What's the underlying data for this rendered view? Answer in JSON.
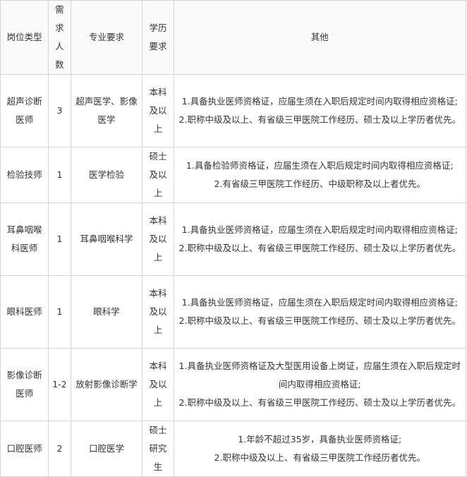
{
  "table": {
    "headers": [
      "岗位类型",
      "需求人数",
      "专业要求",
      "学历要求",
      "其他"
    ],
    "rows": [
      {
        "position": "超声诊断医师",
        "count": "3",
        "major": "超声医学、影像医学",
        "education": "本科及以上",
        "other": [
          "1.具备执业医师资格证，应届生须在入职后规定时间内取得相应资格证;",
          "2.职称中级及以上、有省级三甲医院工作经历、硕士及以上学历者优先。"
        ]
      },
      {
        "position": "检验技师",
        "count": "1",
        "major": "医学检验",
        "education": "硕士及以上",
        "other": [
          "1.具备检验师资格证，应届生须在入职后规定时间内取得相应资格证;",
          "2.有省级三甲医院工作经历、中级职称及以上者优先。"
        ]
      },
      {
        "position": "耳鼻咽喉科医师",
        "count": "1",
        "major": "耳鼻咽喉科学",
        "education": "本科及以上",
        "other": [
          "1.具备执业医师资格证，应届生须在入职后规定时间内取得相应资格证;",
          "2.职称中级及以上、有省级三甲医院工作经历、硕士及以上学历者优先。"
        ]
      },
      {
        "position": "眼科医师",
        "count": "1",
        "major": "眼科学",
        "education": "本科及以上",
        "other": [
          "1.具备执业医师资格证，应届生须在入职后规定时间内取得相应资格证;",
          "2.职称中级及以上、有省级三甲医院工作经历、硕士及以上学历者优先。"
        ]
      },
      {
        "position": "影像诊断医师",
        "count": "1-2",
        "major": "放射影像诊断学",
        "education": "本科及以上",
        "other": [
          "1.具备执业医师资格证及大型医用设备上岗证，应届生须在入职后规定时间内取得相应资格证;",
          "2.职称中级及以上、有省级三甲医院工作经历、硕士及以上学历者优先。"
        ]
      },
      {
        "position": "口腔医师",
        "count": "2",
        "major": "口腔医学",
        "education": "硕士研究生",
        "other": [
          "1.年龄不超过35岁，具备执业医师资格证;",
          "2.职称中级及以上、有省级三甲医院工作经历者优先。"
        ]
      }
    ]
  }
}
